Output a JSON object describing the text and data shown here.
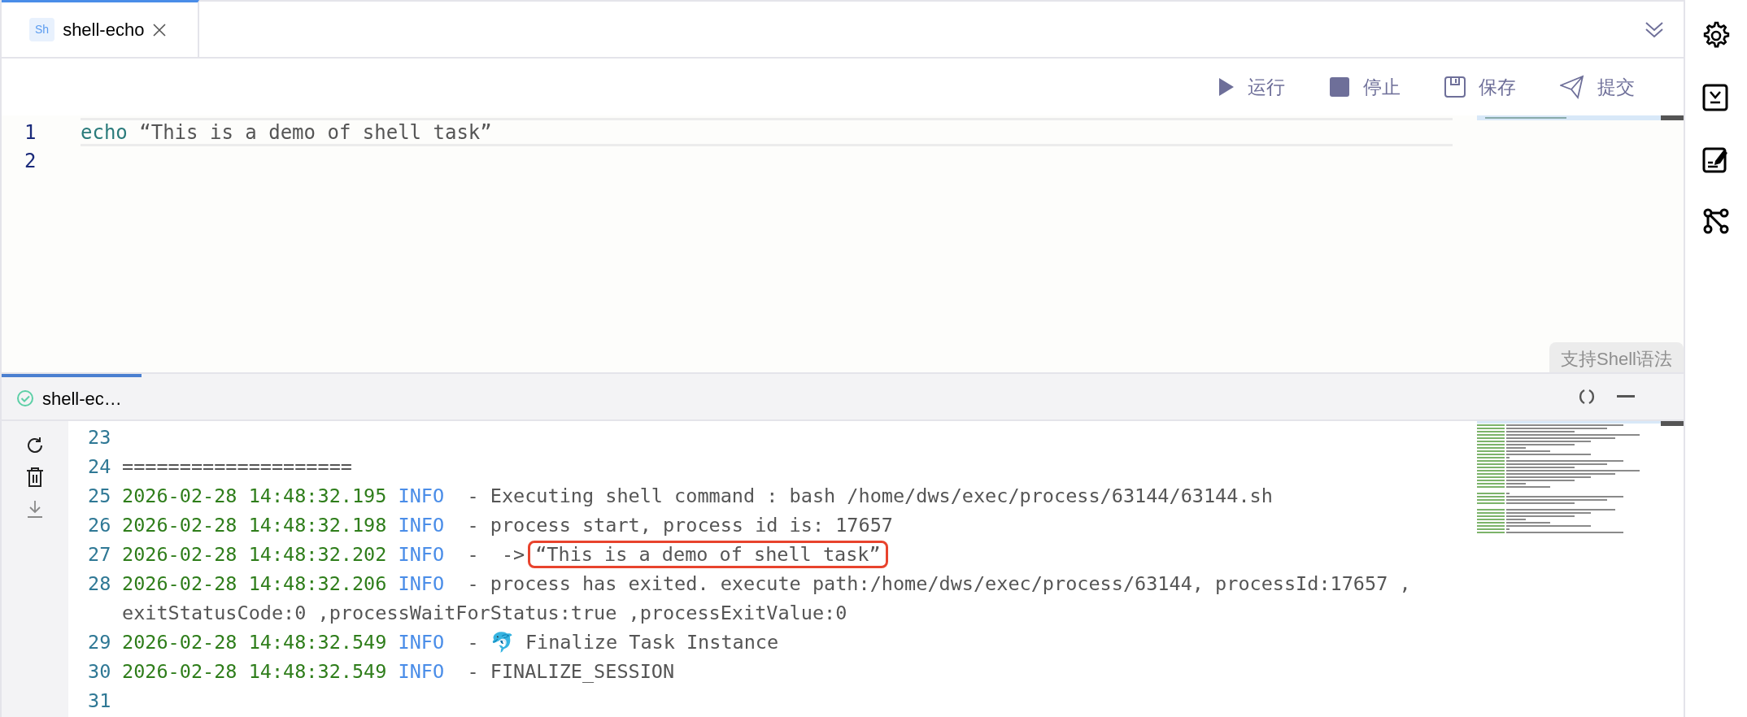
{
  "tabs": [
    {
      "label": "shell-echo",
      "badge": "Sh",
      "selected": true
    }
  ],
  "toolbar": {
    "buttons": [
      {
        "label": "运行",
        "kind": "run"
      },
      {
        "label": "停止",
        "kind": "stop"
      },
      {
        "label": "保存",
        "kind": "save"
      },
      {
        "label": "提交",
        "kind": "submit"
      }
    ]
  },
  "editor": {
    "lines": [
      {
        "number": "1",
        "current": true,
        "tokens": [
          {
            "text": "echo",
            "kind": "keyword"
          },
          {
            "text": " “This is a demo of shell task”",
            "kind": "string"
          }
        ]
      },
      {
        "number": "2",
        "current": false
      }
    ],
    "hint": "支持Shell语法"
  },
  "log_panel": {
    "tab": {
      "label": "shell-ec…",
      "completed": true,
      "selected": true
    },
    "lines": [
      {
        "number": "23",
        "kind": "plain"
      },
      {
        "number": "24",
        "kind": "plain",
        "text": "===================="
      },
      {
        "number": "25",
        "kind": "entry",
        "timestamp": "2026-02-28 14:48:32.195",
        "level": "INFO",
        "message": "  - Executing shell command : bash /home/dws/exec/process/63144/63144.sh"
      },
      {
        "number": "26",
        "kind": "entry",
        "timestamp": "2026-02-28 14:48:32.198",
        "level": "INFO",
        "message": "  - process start, process id is: 17657"
      },
      {
        "number": "27",
        "kind": "entry",
        "timestamp": "2026-02-28 14:48:32.202",
        "level": "INFO",
        "message": "  -  ->",
        "highlight": "“This is a demo of shell task”"
      },
      {
        "number": "28",
        "kind": "entry",
        "timestamp": "2026-02-28 14:48:32.206",
        "level": "INFO",
        "message": "  - process has exited. execute path:/home/dws/exec/process/63144, processId:17657 ,",
        "continuation": "exitStatusCode:0 ,processWaitForStatus:true ,processExitValue:0"
      },
      {
        "number": "29",
        "kind": "entry",
        "timestamp": "2026-02-28 14:48:32.549",
        "level": "INFO",
        "message": "  - 🐬 Finalize Task Instance"
      },
      {
        "number": "30",
        "kind": "entry",
        "timestamp": "2026-02-28 14:48:32.549",
        "level": "INFO",
        "message": "  - FINALIZE_SESSION"
      },
      {
        "number": "31",
        "kind": "plain"
      }
    ]
  },
  "sidebar": {
    "items": [
      {
        "kind": "settings"
      },
      {
        "kind": "download"
      },
      {
        "kind": "edit"
      },
      {
        "kind": "branch"
      }
    ]
  }
}
